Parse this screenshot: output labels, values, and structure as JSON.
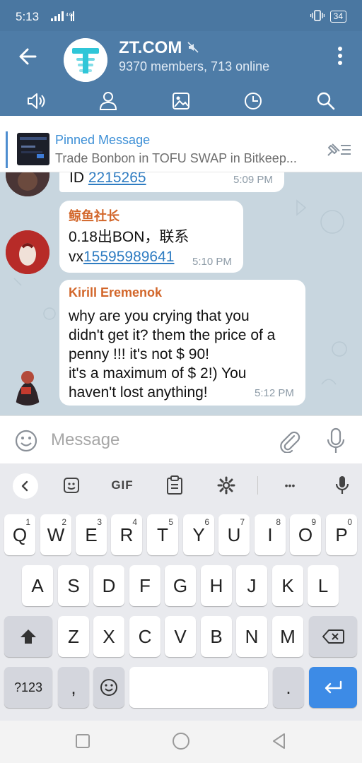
{
  "status_bar": {
    "time": "5:13",
    "signal": "4G",
    "battery": "34"
  },
  "header": {
    "channel_name": "ZT.COM",
    "members": "9370 members, 713 online"
  },
  "pinned": {
    "title": "Pinned Message",
    "text": "Trade Bonbon in TOFU SWAP in Bitkeep..."
  },
  "messages": [
    {
      "text_prefix": "ID ",
      "link": "2215265",
      "time": "5:09 PM"
    },
    {
      "author": "鲸鱼社长",
      "line1": "0.18出BON，联系",
      "text_prefix": "vx",
      "link": "15595989641",
      "time": "5:10 PM"
    },
    {
      "author": "Kirill Eremenok",
      "text": "why are you crying that you\ndidn't get it? them the price of a\npenny !!! it's not $ 90!\nit's a maximum of $ 2!) You\nhaven't lost anything!",
      "time": "5:12 PM"
    }
  ],
  "input": {
    "placeholder": "Message"
  },
  "keyboard": {
    "toolbar_gif": "GIF",
    "toolbar_more": "•••",
    "row1": [
      {
        "k": "Q",
        "n": "1"
      },
      {
        "k": "W",
        "n": "2"
      },
      {
        "k": "E",
        "n": "3"
      },
      {
        "k": "R",
        "n": "4"
      },
      {
        "k": "T",
        "n": "5"
      },
      {
        "k": "Y",
        "n": "6"
      },
      {
        "k": "U",
        "n": "7"
      },
      {
        "k": "I",
        "n": "8"
      },
      {
        "k": "O",
        "n": "9"
      },
      {
        "k": "P",
        "n": "0"
      }
    ],
    "row2": [
      "A",
      "S",
      "D",
      "F",
      "G",
      "H",
      "J",
      "K",
      "L"
    ],
    "row3": [
      "Z",
      "X",
      "C",
      "V",
      "B",
      "N",
      "M"
    ],
    "symbols": "?123",
    "comma": ",",
    "period": "."
  },
  "colors": {
    "header": "#4e7ca7",
    "accent": "#3d8fd6",
    "author": "#d2662a",
    "enter": "#3d8be6"
  }
}
